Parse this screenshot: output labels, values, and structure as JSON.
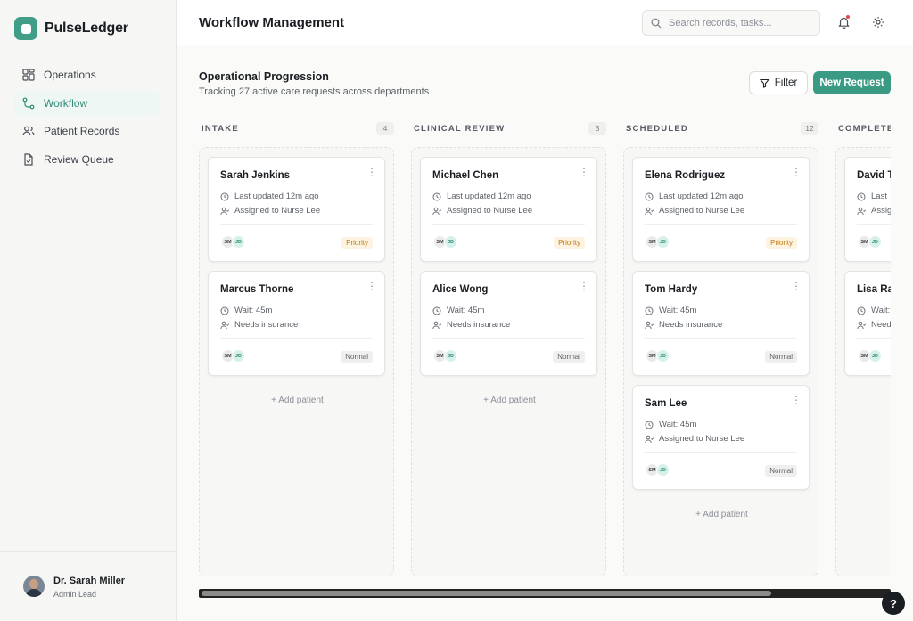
{
  "app": {
    "name": "PulseLedger",
    "accent": "#3a9a84"
  },
  "sidebar": {
    "items": [
      {
        "label": "Operations",
        "icon": "grid-icon"
      },
      {
        "label": "Workflow",
        "icon": "workflow-icon",
        "active": true
      },
      {
        "label": "Patient Records",
        "icon": "users-icon"
      },
      {
        "label": "Review Queue",
        "icon": "file-check-icon"
      }
    ]
  },
  "user": {
    "name": "Dr. Sarah Miller",
    "role": "Admin Lead"
  },
  "header": {
    "title": "Workflow Management",
    "search_placeholder": "Search records, tasks..."
  },
  "main": {
    "title": "Operational Progression",
    "subtitle": "Tracking 27 active care requests across departments",
    "filter_label": "Filter",
    "new_request_label": "New Request",
    "add_patient_label": "+ Add patient"
  },
  "columns": [
    {
      "title": "INTAKE",
      "count": "4",
      "cards": [
        {
          "name": "Sarah Jenkins",
          "line1": "Last updated 12m ago",
          "line2": "Assigned to Nurse Lee",
          "avatars": [
            "SM",
            "JD"
          ],
          "badge": "Priority"
        },
        {
          "name": "Marcus Thorne",
          "line1": "Wait: 45m",
          "line2": "Needs insurance",
          "avatars": [
            "SM",
            "JD"
          ],
          "badge": "Normal"
        }
      ]
    },
    {
      "title": "CLINICAL REVIEW",
      "count": "3",
      "cards": [
        {
          "name": "Michael Chen",
          "line1": "Last updated 12m ago",
          "line2": "Assigned to Nurse Lee",
          "avatars": [
            "SM",
            "JD"
          ],
          "badge": "Priority"
        },
        {
          "name": "Alice Wong",
          "line1": "Wait: 45m",
          "line2": "Needs insurance",
          "avatars": [
            "SM",
            "JD"
          ],
          "badge": "Normal"
        }
      ]
    },
    {
      "title": "SCHEDULED",
      "count": "12",
      "cards": [
        {
          "name": "Elena Rodriguez",
          "line1": "Last updated 12m ago",
          "line2": "Assigned to Nurse Lee",
          "avatars": [
            "SM",
            "JD"
          ],
          "badge": "Priority"
        },
        {
          "name": "Tom Hardy",
          "line1": "Wait: 45m",
          "line2": "Needs insurance",
          "avatars": [
            "SM",
            "JD"
          ],
          "badge": "Normal"
        },
        {
          "name": "Sam Lee",
          "line1": "Wait: 45m",
          "line2": "Assigned to Nurse Lee",
          "avatars": [
            "SM",
            "JD"
          ],
          "badge": "Normal"
        }
      ]
    },
    {
      "title": "COMPLETE",
      "count": "",
      "cards": [
        {
          "name": "David T",
          "line1": "Last",
          "line2": "Assig",
          "avatars": [
            "SM",
            "JD"
          ],
          "badge": ""
        },
        {
          "name": "Lisa Ra",
          "line1": "Wait:",
          "line2": "Need",
          "avatars": [
            "SM",
            "JD"
          ],
          "badge": ""
        }
      ]
    }
  ],
  "help_label": "?"
}
